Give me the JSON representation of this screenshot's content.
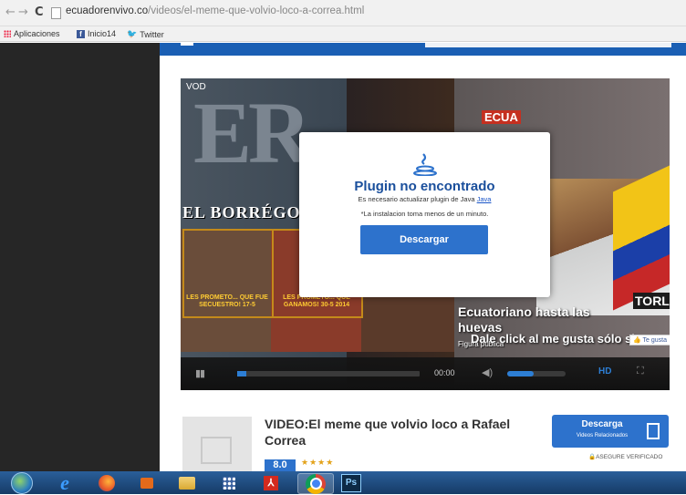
{
  "browser": {
    "url_host": "ecuadorenvivo.co",
    "url_path": "/videos/el-meme-que-volvio-loco-a-correa.html",
    "bookmarks": {
      "apps": "Aplicaciones",
      "inicio": "Inicio14",
      "twitter": "Twitter"
    }
  },
  "player": {
    "vod_label": "VOD",
    "overlay_title_1": "Ecuatoriano hasta las",
    "overlay_title_2": "huevas",
    "overlay_click": "Dale click al me gusta sólo si",
    "overlay_sub": "Figura pública",
    "like_button": "Te gusta",
    "time": "00:00",
    "hd": "HD",
    "progress": 0.05,
    "volume": 0.45
  },
  "modal": {
    "title": "Plugin no encontrado",
    "text1": "Es necesario actualizar plugin de Java",
    "text1_link": "Java",
    "text2": "*La instalacion toma menos de un minuto.",
    "button": "Descargar"
  },
  "video_info": {
    "title": "VIDEO:El meme que volvio loco a Rafael Correa",
    "rating": "8.0",
    "stars": "★★★★"
  },
  "download": {
    "label": "Descarga",
    "sub": "Videos Relacionados",
    "verified": "ASEGURE VERIFICADO"
  },
  "colors": {
    "accent": "#2d72cc",
    "modal_title": "#1a4f9c",
    "left_panel": "#262626"
  }
}
